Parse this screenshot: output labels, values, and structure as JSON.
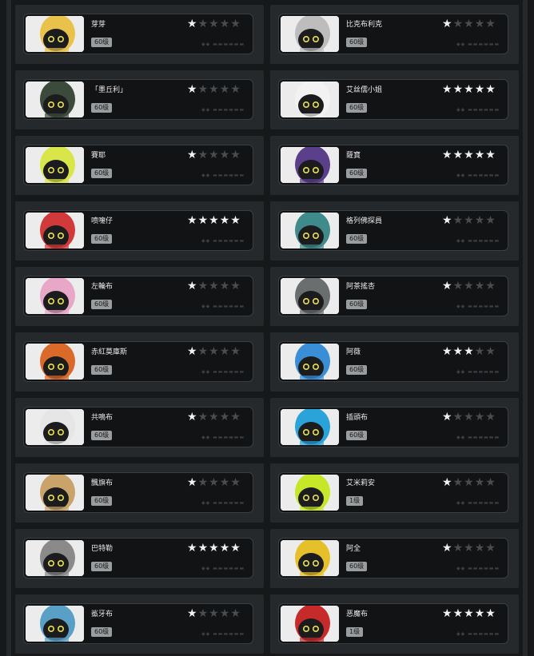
{
  "colors": {
    "background": "#16181a",
    "cell": "#26292b",
    "card": "#121315",
    "star_on": "#f2f2f2",
    "star_off": "#4a4d50",
    "level_badge": "#9a9d9f"
  },
  "cards": [
    {
      "name": "芽芽",
      "level": "60级",
      "stars": 1,
      "portrait": "yellow-hair-mask",
      "theme": "#e8c24a"
    },
    {
      "name": "比克布利克",
      "level": "60级",
      "stars": 1,
      "portrait": "robot-mask",
      "theme": "#bdbdbd"
    },
    {
      "name": "「墨丘利」",
      "level": "60级",
      "stars": 1,
      "portrait": "dark-helmet",
      "theme": "#3c4a3c"
    },
    {
      "name": "艾丝儒小姐",
      "level": "60级",
      "stars": 5,
      "portrait": "bunny-blue-scarf",
      "theme": "#f2f2f2"
    },
    {
      "name": "賽耶",
      "level": "60级",
      "stars": 1,
      "portrait": "lime-pilot-cap",
      "theme": "#d9e64a"
    },
    {
      "name": "薩寶",
      "level": "60级",
      "stars": 5,
      "portrait": "purple-bandana",
      "theme": "#5a3f8a"
    },
    {
      "name": "喷嚏仔",
      "level": "60级",
      "stars": 5,
      "portrait": "red-cap",
      "theme": "#d13a3a"
    },
    {
      "name": "格列佛探員",
      "level": "60级",
      "stars": 1,
      "portrait": "teal-pith-helmet",
      "theme": "#3f8a8a"
    },
    {
      "name": "左輪布",
      "level": "60级",
      "stars": 1,
      "portrait": "pink-flower",
      "theme": "#e8a7c7"
    },
    {
      "name": "阿茶搖杏",
      "level": "60级",
      "stars": 1,
      "portrait": "gray-hood",
      "theme": "#6a6e6e"
    },
    {
      "name": "赤紅莫庫斯",
      "level": "60级",
      "stars": 1,
      "portrait": "orange-fox-mask",
      "theme": "#d96a2a"
    },
    {
      "name": "阿薇",
      "level": "60级",
      "stars": 3,
      "portrait": "blue-cap-pink",
      "theme": "#3a8ed6"
    },
    {
      "name": "共鳴布",
      "level": "60级",
      "stars": 1,
      "portrait": "white-headphones",
      "theme": "#e6e6e6"
    },
    {
      "name": "插頭布",
      "level": "60级",
      "stars": 1,
      "portrait": "blue-dome",
      "theme": "#2aa3d9"
    },
    {
      "name": "飄旗布",
      "level": "60级",
      "stars": 1,
      "portrait": "aviator-goggles",
      "theme": "#c9a36a"
    },
    {
      "name": "艾米莉安",
      "level": "1级",
      "stars": 1,
      "portrait": "lime-red-x",
      "theme": "#c6e62a"
    },
    {
      "name": "巴特勒",
      "level": "60级",
      "stars": 5,
      "portrait": "gray-mask-bunny",
      "theme": "#8a8a8a"
    },
    {
      "name": "阿全",
      "level": "60级",
      "stars": 1,
      "portrait": "yellow-hardhat",
      "theme": "#e6c02a"
    },
    {
      "name": "鯊牙布",
      "level": "60级",
      "stars": 1,
      "portrait": "shark-hood",
      "theme": "#5aa0c6"
    },
    {
      "name": "恶魔布",
      "level": "1级",
      "stars": 5,
      "portrait": "red-devil",
      "theme": "#c62a2a"
    }
  ]
}
